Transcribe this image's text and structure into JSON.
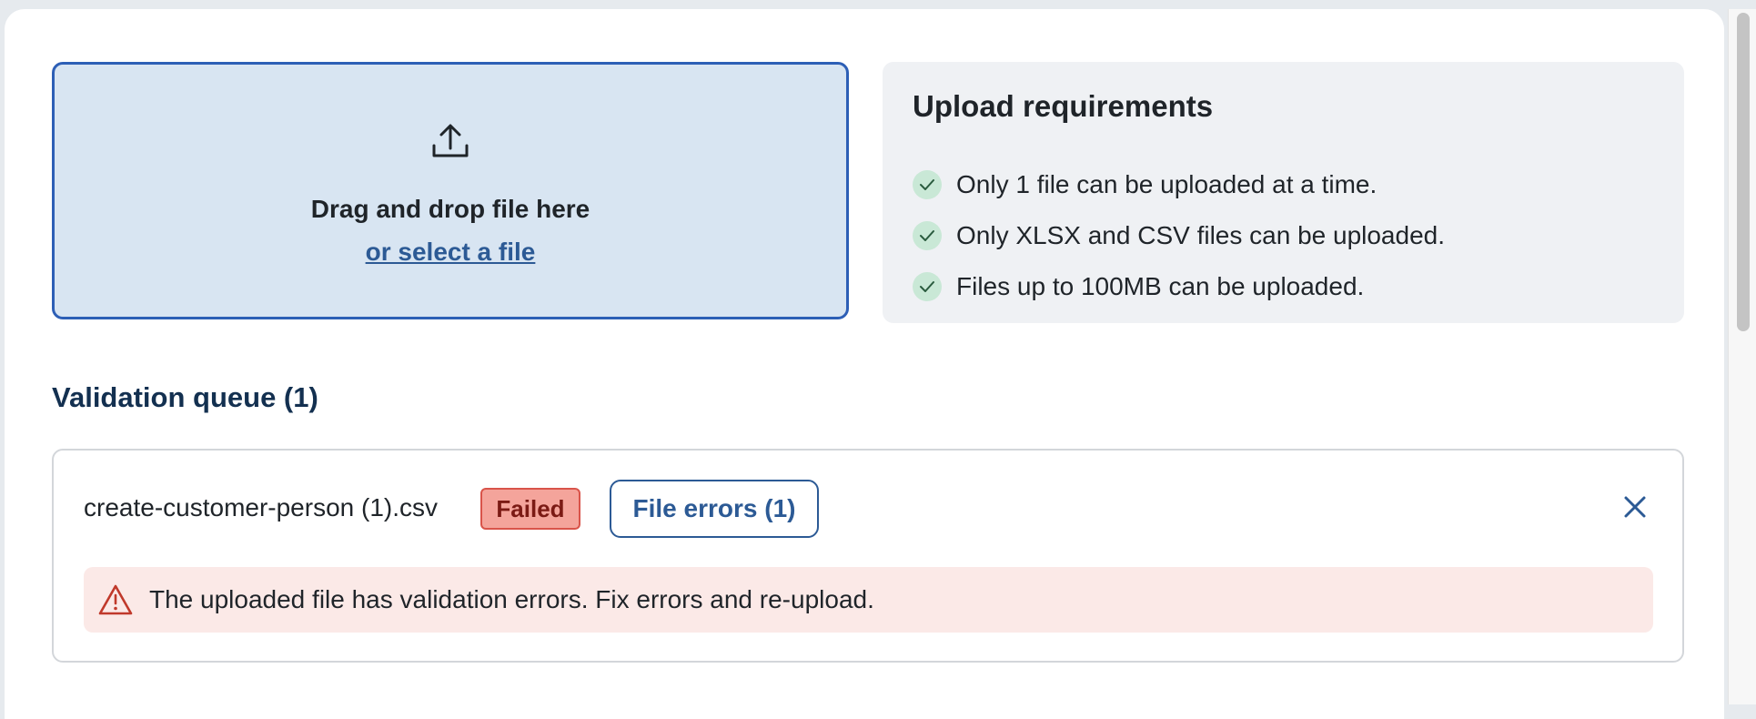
{
  "dropzone": {
    "title": "Drag and drop file here",
    "select_link": "or select a file",
    "icon": "upload-icon"
  },
  "requirements": {
    "title": "Upload requirements",
    "items": [
      "Only 1 file can be uploaded at a time.",
      "Only XLSX and CSV files can be uploaded.",
      "Files up to 100MB can be uploaded."
    ],
    "item_icon": "check-icon"
  },
  "queue": {
    "title": "Validation queue (1)",
    "file": {
      "name": "create-customer-person (1).csv",
      "status": "Failed",
      "errors_button": "File errors (1)",
      "alert": "The uploaded file has validation errors. Fix errors and re-upload."
    }
  },
  "colors": {
    "accent": "#2c5a95",
    "dropzone_bg": "#d8e5f2",
    "dropzone_border": "#2d5fb6",
    "failed_bg": "#f4a49b",
    "failed_border": "#d9544a",
    "alert_bg": "#fbe9e7",
    "check_bg": "#c9e8d6"
  }
}
